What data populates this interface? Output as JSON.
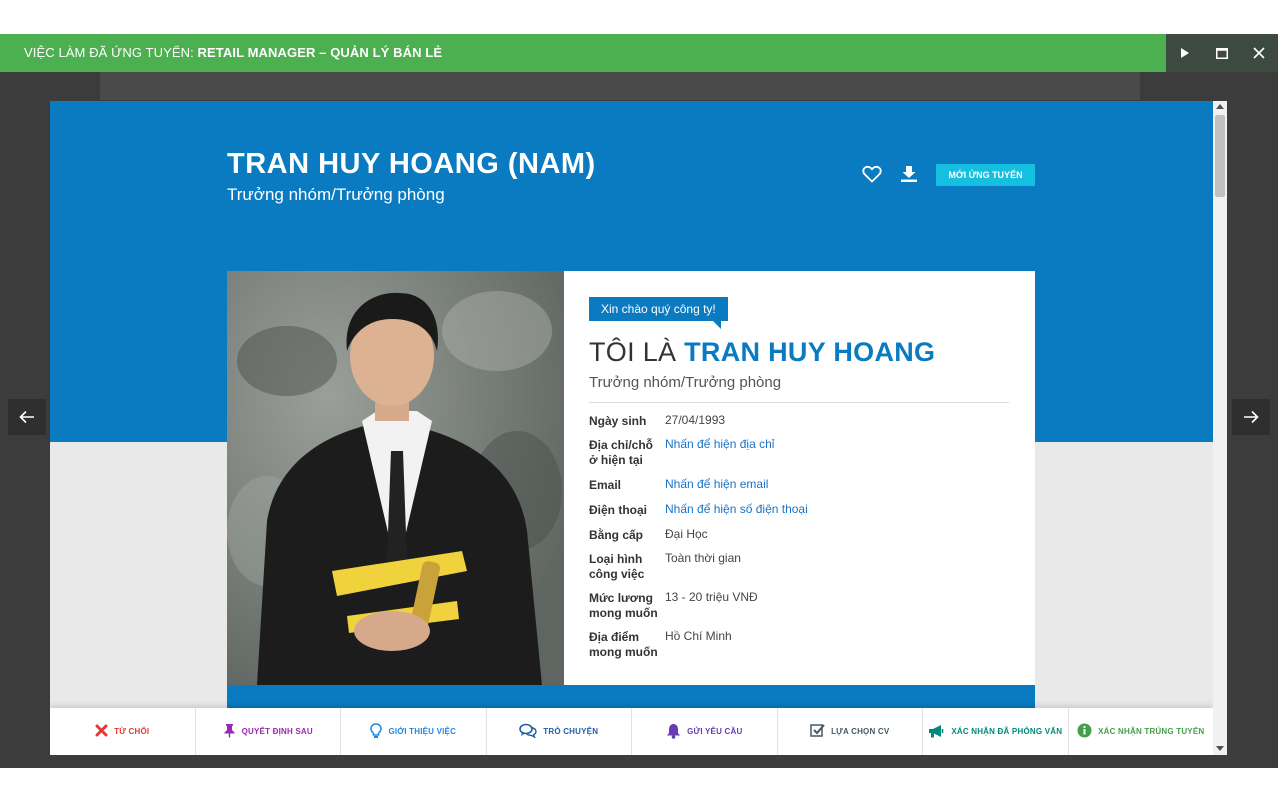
{
  "topbar": {
    "prefix": "VIỆC LÀM ĐÃ ỨNG TUYỂN:",
    "job_title": "RETAIL MANAGER – QUẢN LÝ BÁN LẺ",
    "icons": [
      "play-icon",
      "maximize-icon",
      "close-icon"
    ]
  },
  "header": {
    "name": "TRAN HUY HOANG (NAM)",
    "position": "Trưởng nhóm/Trưởng phòng",
    "status_button": "MỚI ỨNG TUYỂN",
    "icons": [
      "heart-icon",
      "download-icon"
    ]
  },
  "profile": {
    "greeting": "Xin chào quý công ty!",
    "intro_prefix": "TÔI LÀ",
    "intro_name": "TRAN HUY HOANG",
    "role": "Trưởng nhóm/Trưởng phòng",
    "fields": [
      {
        "label": "Ngày sinh",
        "value": "27/04/1993",
        "link": false
      },
      {
        "label": "Địa chỉ/chỗ ở hiện tại",
        "value": "Nhấn để hiện địa chỉ",
        "link": true
      },
      {
        "label": "Email",
        "value": "Nhấn để hiện email",
        "link": true
      },
      {
        "label": "Điện thoại",
        "value": "Nhấn để hiện số điện thoại",
        "link": true
      },
      {
        "label": "Bằng cấp",
        "value": "Đại Học",
        "link": false
      },
      {
        "label": "Loại hình công việc",
        "value": "Toàn thời gian",
        "link": false
      },
      {
        "label": "Mức lương mong muốn",
        "value": "13 - 20 triệu VNĐ",
        "link": false
      },
      {
        "label": "Địa điểm mong muốn",
        "value": "Hồ Chí Minh",
        "link": false
      }
    ]
  },
  "actions": [
    {
      "label": "TỪ CHỐI",
      "icon": "x-icon",
      "color": "#e53935"
    },
    {
      "label": "QUYẾT ĐỊNH SAU",
      "icon": "pin-icon",
      "color": "#9c27b0"
    },
    {
      "label": "GIỚI THIỆU VIỆC",
      "icon": "lightbulb-icon",
      "color": "#1e88e5"
    },
    {
      "label": "TRÒ CHUYỆN",
      "icon": "chat-icon",
      "color": "#1e5fa8"
    },
    {
      "label": "GỬI YÊU CẦU",
      "icon": "bell-icon",
      "color": "#673ab7"
    },
    {
      "label": "LỰA CHỌN CV",
      "icon": "checkbox-icon",
      "color": "#455a64"
    },
    {
      "label": "XÁC NHẬN ĐÃ PHỎNG VẤN",
      "icon": "megaphone-icon",
      "color": "#00897b"
    },
    {
      "label": "XÁC NHẬN TRÚNG TUYỂN",
      "icon": "info-icon",
      "color": "#43a047"
    }
  ],
  "colors": {
    "topbar": "#4caf50",
    "banner": "#0a7bc0",
    "status_button": "#14bfe0"
  }
}
